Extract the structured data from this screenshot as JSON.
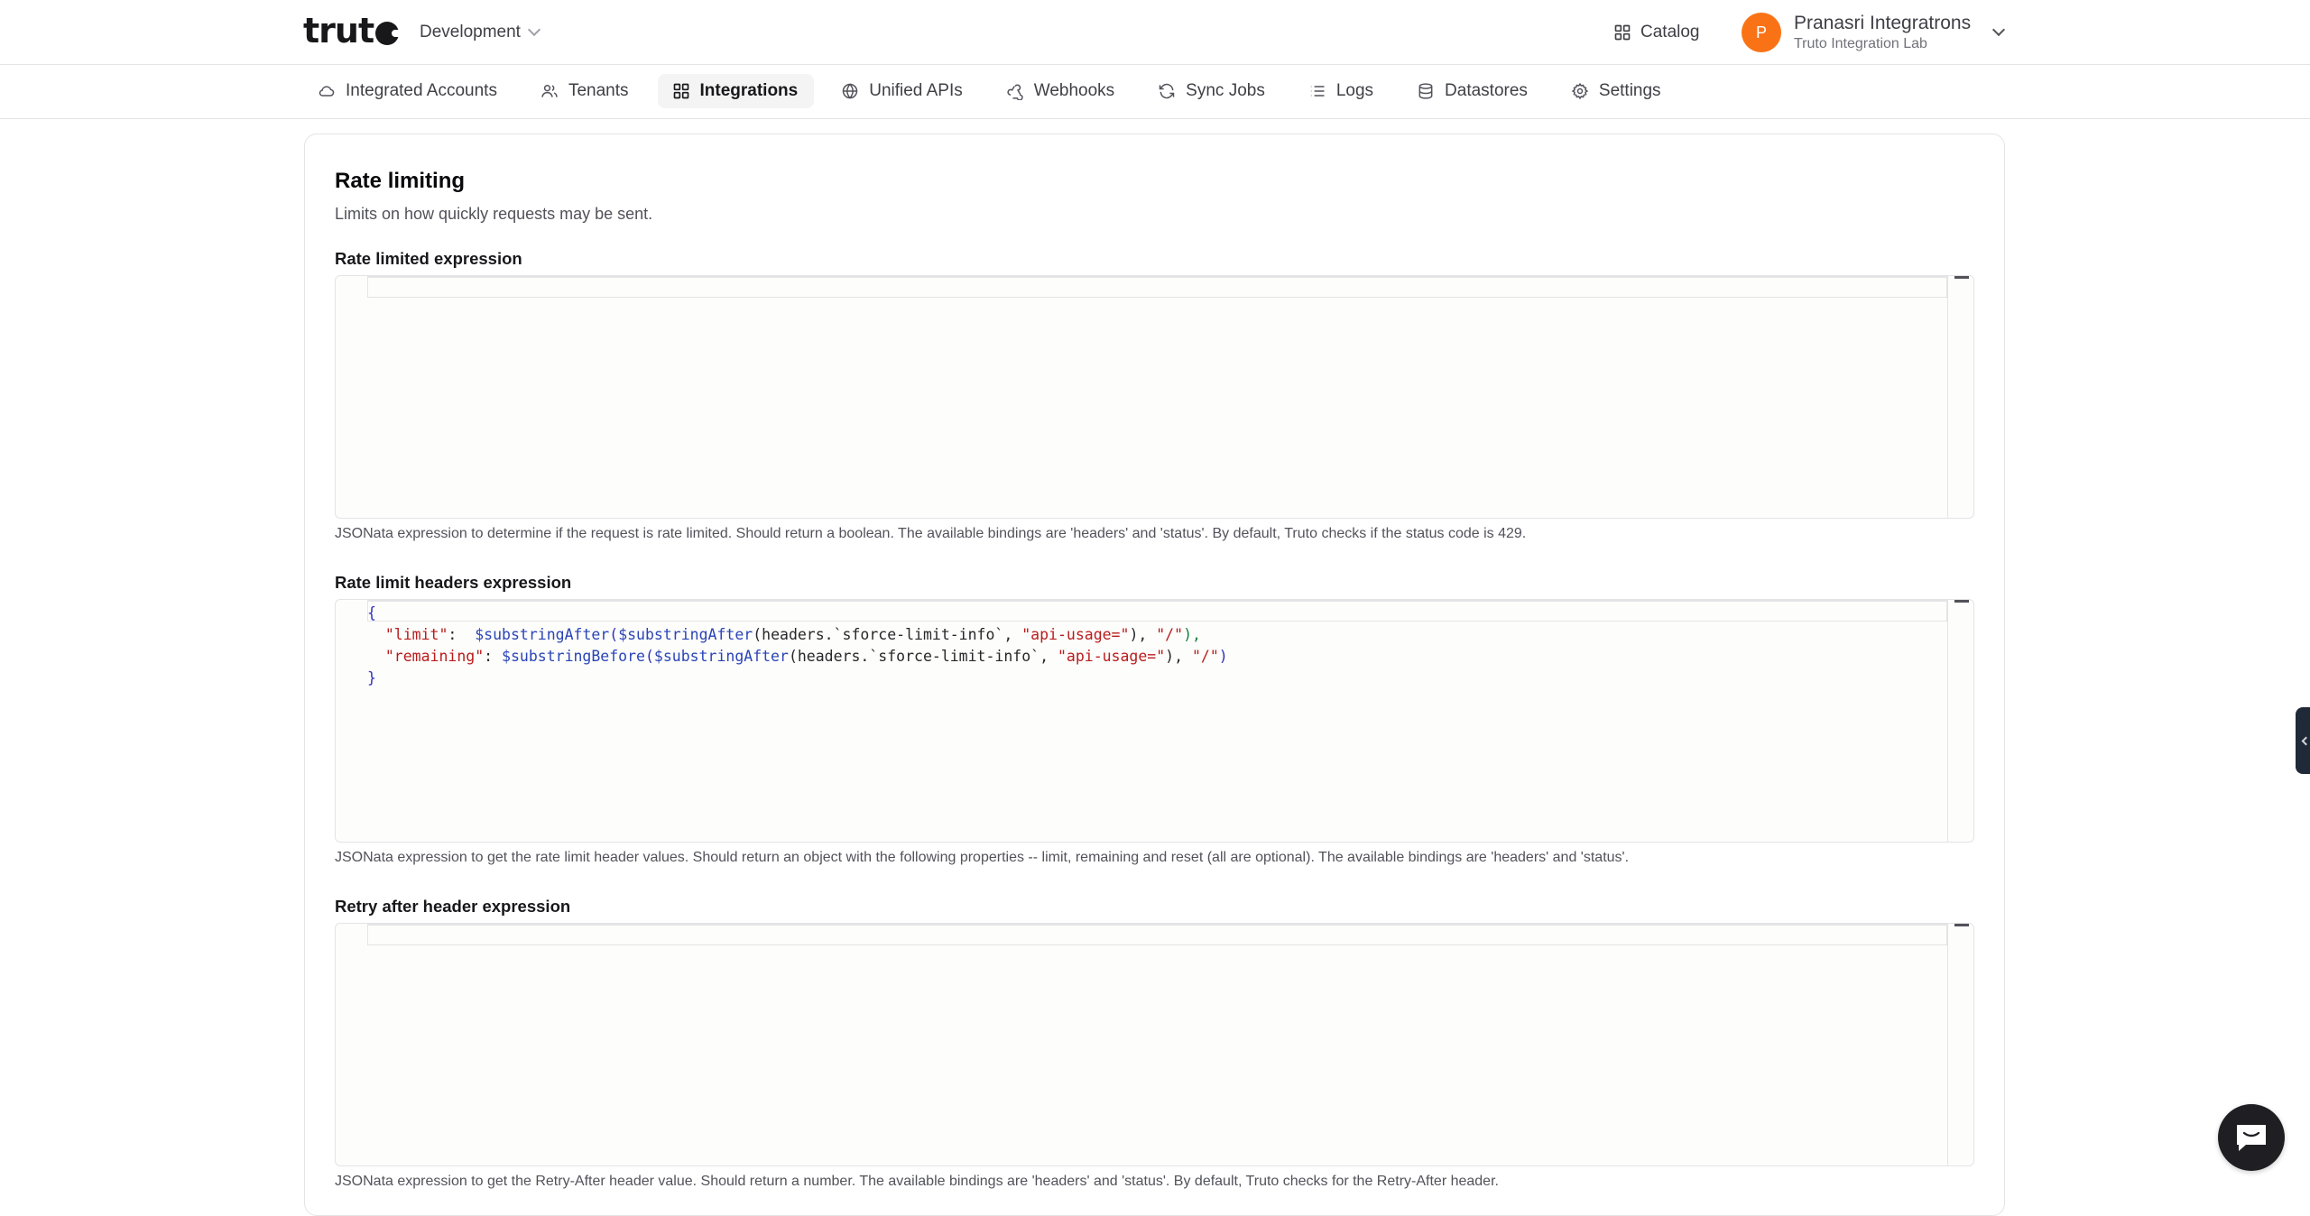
{
  "header": {
    "logo_text": "trut",
    "environment": "Development",
    "catalog_label": "Catalog",
    "user": {
      "initial": "P",
      "name": "Pranasri Integratrons",
      "org": "Truto Integration Lab"
    }
  },
  "nav": {
    "tabs": [
      {
        "label": "Integrated Accounts",
        "icon": "cloud-icon",
        "active": false
      },
      {
        "label": "Tenants",
        "icon": "users-icon",
        "active": false
      },
      {
        "label": "Integrations",
        "icon": "grid-icon",
        "active": true
      },
      {
        "label": "Unified APIs",
        "icon": "globe-icon",
        "active": false
      },
      {
        "label": "Webhooks",
        "icon": "webhook-icon",
        "active": false
      },
      {
        "label": "Sync Jobs",
        "icon": "sync-icon",
        "active": false
      },
      {
        "label": "Logs",
        "icon": "list-icon",
        "active": false
      },
      {
        "label": "Datastores",
        "icon": "database-icon",
        "active": false
      },
      {
        "label": "Settings",
        "icon": "gear-icon",
        "active": false
      }
    ]
  },
  "section": {
    "title": "Rate limiting",
    "subtitle": "Limits on how quickly requests may be sent."
  },
  "fields": {
    "rate_limited": {
      "label": "Rate limited expression",
      "value": "",
      "help": "JSONata expression to determine if the request is rate limited. Should return a boolean. The available bindings are 'headers' and 'status'. By default, Truto checks if the status code is 429."
    },
    "headers": {
      "label": "Rate limit headers expression",
      "code": {
        "l1": "{",
        "l2_key": "\"limit\"",
        "l2_colon": ":  ",
        "l2_fn1": "$substringAfter",
        "l2_p1": "(",
        "l2_fn2": "$substringAfter",
        "l2_p2": "(headers.`sforce-limit-info`, ",
        "l2_s1": "\"api-usage=\"",
        "l2_p3": "), ",
        "l2_s2": "\"/\"",
        "l2_end": "),",
        "l3_key": "\"remaining\"",
        "l3_colon": ": ",
        "l3_fn1": "$substringBefore",
        "l3_p1": "(",
        "l3_fn2": "$substringAfter",
        "l3_p2": "(headers.`sforce-limit-info`, ",
        "l3_s1": "\"api-usage=\"",
        "l3_p3": "), ",
        "l3_s2": "\"/\"",
        "l3_end": ")",
        "l4": "}"
      },
      "help": "JSONata expression to get the rate limit header values. Should return an object with the following properties -- limit, remaining and reset (all are optional). The available bindings are 'headers' and 'status'."
    },
    "retry_after": {
      "label": "Retry after header expression",
      "value": "",
      "help": "JSONata expression to get the Retry-After header value. Should return a number. The available bindings are 'headers' and 'status'. By default, Truto checks for the Retry-After header."
    }
  },
  "colors": {
    "avatar": "#f97316",
    "string": "#b91c1c",
    "function": "#2a44b8",
    "brace": "#3030c0"
  }
}
